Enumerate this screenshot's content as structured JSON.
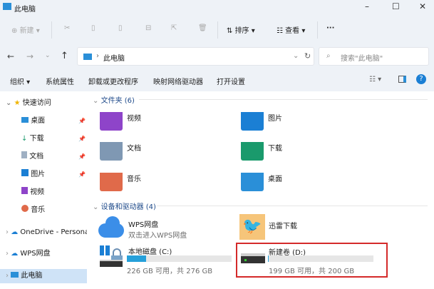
{
  "window": {
    "title": "此电脑"
  },
  "toolbar": {
    "new": "新建",
    "sort": "排序",
    "view": "查看",
    "more": "···"
  },
  "address": {
    "path": "此电脑",
    "search_placeholder": "搜索\"此电脑\""
  },
  "commands": [
    "组织 ▾",
    "系统属性",
    "卸载或更改程序",
    "映射网络驱动器",
    "打开设置"
  ],
  "sidebar": {
    "quick_access": "快速访问",
    "items": [
      "桌面",
      "下载",
      "文档",
      "图片",
      "视频",
      "音乐"
    ],
    "onedrive": "OneDrive - Personal",
    "wps": "WPS网盘",
    "this_pc": "此电脑"
  },
  "folders": {
    "header": "文件夹 (6)",
    "items": [
      {
        "name": "视频",
        "color": "#8e44c9"
      },
      {
        "name": "图片",
        "color": "#1b7fd4"
      },
      {
        "name": "文档",
        "color": "#7f98b3"
      },
      {
        "name": "下载",
        "color": "#1a9a6c"
      },
      {
        "name": "音乐",
        "color": "#e06a4a"
      },
      {
        "name": "桌面",
        "color": "#2a8fd8"
      }
    ]
  },
  "devices": {
    "header": "设备和驱动器 (4)",
    "wps": {
      "name": "WPS网盘",
      "sub": "双击进入WPS网盘"
    },
    "xunlei": {
      "name": "迅雷下载"
    },
    "c": {
      "name": "本地磁盘 (C:)",
      "info": "226 GB 可用，共 276 GB",
      "used_fraction": 0.181
    },
    "d": {
      "name": "新建卷 (D:)",
      "info": "199 GB 可用，共 200 GB",
      "used_fraction": 0.005
    }
  },
  "highlight_color": "#d42a2a"
}
